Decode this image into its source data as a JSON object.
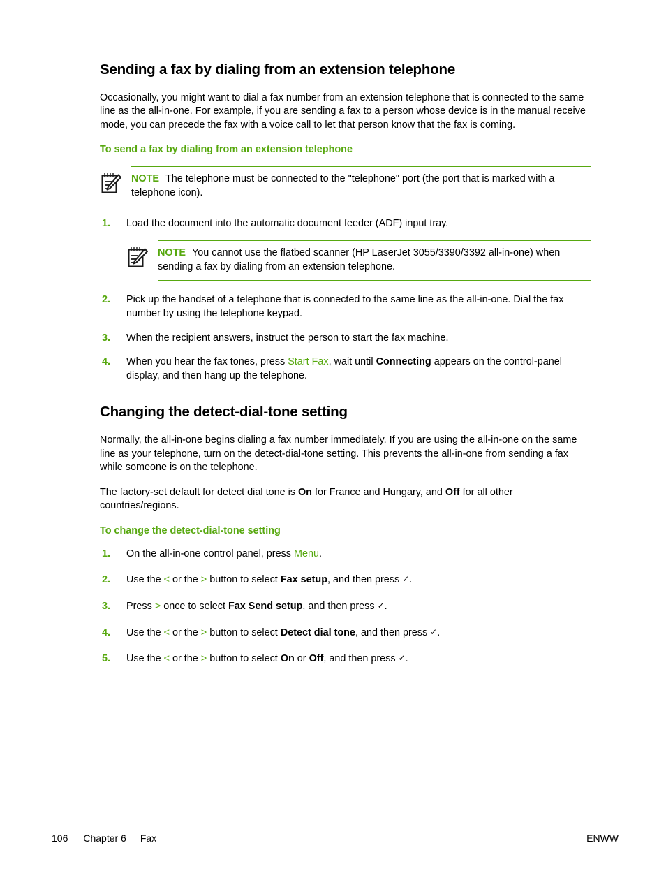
{
  "document": {
    "section1": {
      "title": "Sending a fax by dialing from an extension telephone",
      "intro": "Occasionally, you might want to dial a fax number from an extension telephone that is connected to the same line as the all-in-one. For example, if you are sending a fax to a person whose device is in the manual receive mode, you can precede the fax with a voice call to let that person know that the fax is coming.",
      "procedure_heading": "To send a fax by dialing from an extension telephone",
      "note1": {
        "label": "NOTE",
        "text": "The telephone must be connected to the \"telephone\" port (the port that is marked with a telephone icon)."
      },
      "steps": [
        {
          "num": "1.",
          "text": "Load the document into the automatic document feeder (ADF) input tray."
        },
        {
          "num": "2.",
          "text": "Pick up the handset of a telephone that is connected to the same line as the all-in-one. Dial the fax number by using the telephone keypad."
        },
        {
          "num": "3.",
          "text": "When the recipient answers, instruct the person to start the fax machine."
        },
        {
          "num": "4.",
          "text_part1": "When you hear the fax tones, press ",
          "key": "Start Fax",
          "text_part2": ", wait until ",
          "bold": "Connecting",
          "text_part3": " appears on the control-panel display, and then hang up the telephone."
        }
      ],
      "note2": {
        "label": "NOTE",
        "text": "You cannot use the flatbed scanner (HP LaserJet 3055/3390/3392 all-in-one) when sending a fax by dialing from an extension telephone."
      }
    },
    "section2": {
      "title": "Changing the detect-dial-tone setting",
      "para1": "Normally, the all-in-one begins dialing a fax number immediately. If you are using the all-in-one on the same line as your telephone, turn on the detect-dial-tone setting. This prevents the all-in-one from sending a fax while someone is on the telephone.",
      "para2_part1": "The factory-set default for detect dial tone is ",
      "para2_on": "On",
      "para2_part2": " for France and Hungary, and ",
      "para2_off": "Off",
      "para2_part3": " for all other countries/regions.",
      "procedure_heading": "To change the detect-dial-tone setting",
      "steps": [
        {
          "num": "1.",
          "text_part1": "On the all-in-one control panel, press ",
          "key": "Menu",
          "text_part2": "."
        },
        {
          "num": "2.",
          "text_part1": "Use the ",
          "key_left": "<",
          "text_part2": " or the ",
          "key_right": ">",
          "text_part3": " button to select ",
          "bold": "Fax setup",
          "text_part4": ", and then press ",
          "check": "✓",
          "text_part5": "."
        },
        {
          "num": "3.",
          "text_part1": "Press ",
          "key_right": ">",
          "text_part2": " once to select ",
          "bold": "Fax Send setup",
          "text_part3": ", and then press ",
          "check": "✓",
          "text_part4": "."
        },
        {
          "num": "4.",
          "text_part1": "Use the ",
          "key_left": "<",
          "text_part2": " or the ",
          "key_right": ">",
          "text_part3": " button to select ",
          "bold": "Detect dial tone",
          "text_part4": ", and then press ",
          "check": "✓",
          "text_part5": "."
        },
        {
          "num": "5.",
          "text_part1": "Use the ",
          "key_left": "<",
          "text_part2": " or the ",
          "key_right": ">",
          "text_part3": " button to select ",
          "bold_on": "On",
          "text_part4": " or ",
          "bold_off": "Off",
          "text_part5": ", and then press ",
          "check": "✓",
          "text_part6": "."
        }
      ]
    },
    "footer": {
      "page_number": "106",
      "chapter": "Chapter 6",
      "chapter_title": "Fax",
      "locale": "ENWW"
    },
    "colors": {
      "accent_green": "#57a80f",
      "text_black": "#000000",
      "background": "#ffffff"
    },
    "icons": {
      "note": "note-pencil-icon"
    }
  }
}
